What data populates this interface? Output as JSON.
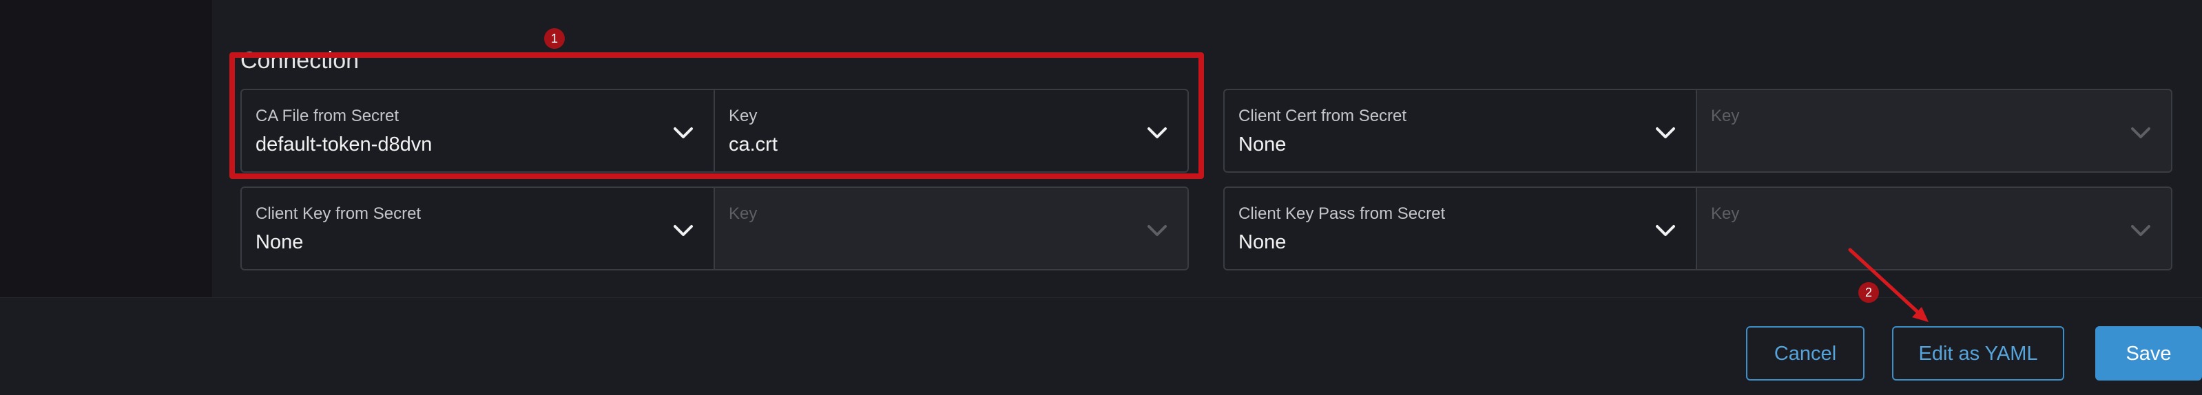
{
  "section": {
    "title": "Connection"
  },
  "fields": {
    "ca_file": {
      "label": "CA File from Secret",
      "value": "default-token-d8dvn"
    },
    "ca_key": {
      "label": "Key",
      "value": "ca.crt"
    },
    "client_cert": {
      "label": "Client Cert from Secret",
      "value": "None"
    },
    "client_cert_key": {
      "label": "Key",
      "value": ""
    },
    "client_key": {
      "label": "Client Key from Secret",
      "value": "None"
    },
    "client_key_key": {
      "label": "Key",
      "value": ""
    },
    "client_key_pass": {
      "label": "Client Key Pass from Secret",
      "value": "None"
    },
    "client_key_pass_key": {
      "label": "Key",
      "value": ""
    }
  },
  "annotations": {
    "badge_1": "1",
    "badge_2": "2",
    "highlight_color": "#c7141a"
  },
  "footer": {
    "cancel_label": "Cancel",
    "edit_yaml_label": "Edit as YAML",
    "save_label": "Save"
  },
  "colors": {
    "accent": "#3a91d2",
    "background": "#1b1c21",
    "border": "#3a3c44"
  },
  "icons": {
    "dropdown": "chevron-down-icon"
  }
}
